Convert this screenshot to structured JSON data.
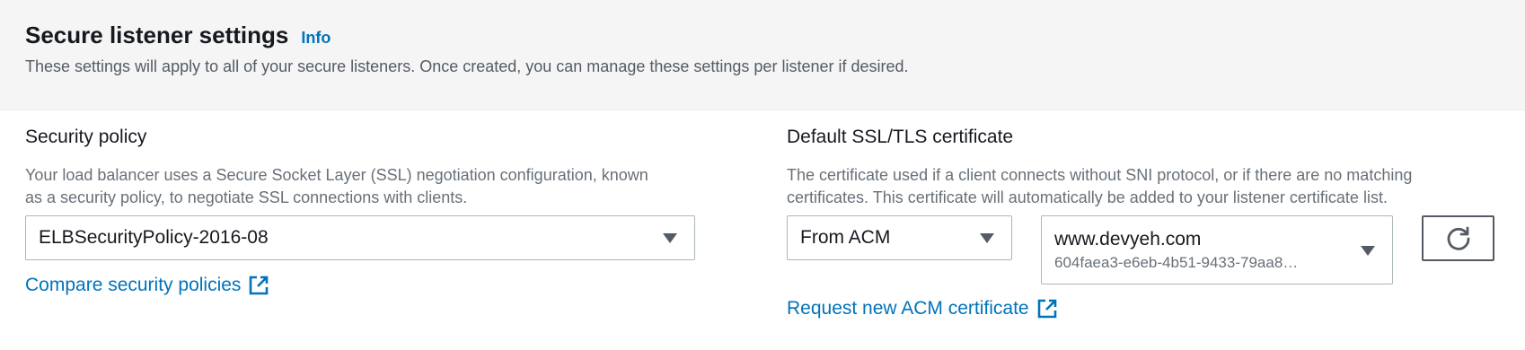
{
  "header": {
    "title": "Secure listener settings",
    "info_link": "Info",
    "description": "These settings will apply to all of your secure listeners. Once created, you can manage these settings per listener if desired."
  },
  "security_policy": {
    "label": "Security policy",
    "help_line1": "Your load balancer uses a Secure Socket Layer (SSL) negotiation configuration, known",
    "help_line2": "as a security policy, to negotiate SSL connections with clients.",
    "selected": "ELBSecurityPolicy-2016-08",
    "compare_link": "Compare security policies"
  },
  "certificate": {
    "label": "Default SSL/TLS certificate",
    "help_line1": "The certificate used if a client connects without SNI protocol, or if there are no matching",
    "help_line2": "certificates. This certificate will automatically be added to your listener certificate list.",
    "source_selected": "From ACM",
    "cert_name": "www.devyeh.com",
    "cert_id": "604faea3-e6eb-4b51-9433-79aa8…",
    "request_link": "Request new ACM certificate"
  },
  "icons": {
    "external": "external-link-icon",
    "caret": "caret-down-icon",
    "refresh": "refresh-icon"
  },
  "colors": {
    "link": "#0073bb",
    "header_bg": "#f5f5f5",
    "border": "#aab7b8"
  }
}
